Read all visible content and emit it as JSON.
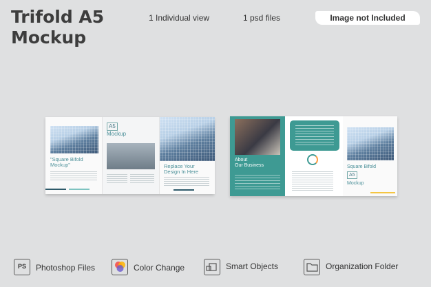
{
  "title_line1": "Trifold A5",
  "title_line2": "Mockup",
  "views": "1 Individual view",
  "files": "1 psd files",
  "badge": "Image not Included",
  "left_brochure": {
    "panel1_heading": "\"Square Bifold Mockup\"",
    "panel2_line1": "A5",
    "panel2_line2": "Mockup",
    "panel3_heading": "Replace Your Design In Here"
  },
  "right_brochure": {
    "panel1_heading_line1": "About",
    "panel1_heading_line2": "Our Business",
    "panel3_heading": "Square Bifold",
    "panel3_box": "A5",
    "panel3_footer": "Mockup"
  },
  "features": [
    {
      "label": "Photoshop Files",
      "icon_text": "PS",
      "icon": "photoshop-icon"
    },
    {
      "label": "Color Change",
      "icon": "color-change-icon"
    },
    {
      "label": "Smart Objects",
      "icon": "smart-objects-icon"
    },
    {
      "label": "Organization Folder",
      "icon": "folder-icon"
    }
  ],
  "colors": {
    "accent": "#3e9a93",
    "background": "#dfe0e1"
  }
}
